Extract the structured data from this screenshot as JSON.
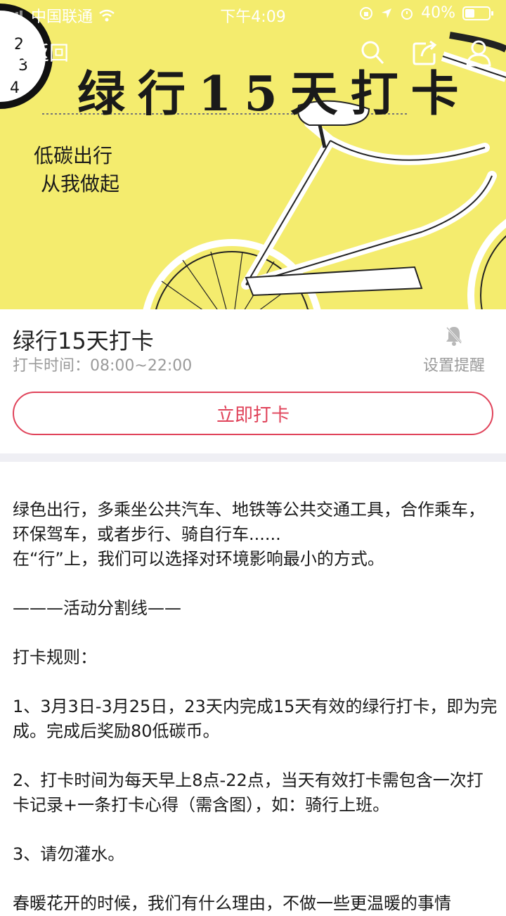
{
  "status_bar": {
    "carrier": "中国联通",
    "time": "下午4:09",
    "battery": "40%"
  },
  "nav": {
    "back_label": "返回"
  },
  "hero": {
    "title": "绿行15天打卡",
    "slogan_line1": "低碳出行",
    "slogan_line2": "从我做起",
    "background_color": "#f4ec6e"
  },
  "activity": {
    "title": "绿行15天打卡",
    "time_text": "打卡时间：08:00~22:00",
    "remind_label": "设置提醒",
    "checkin_label": "立即打卡",
    "accent_color": "#e0435a"
  },
  "description": [
    "绿色出行，多乘坐公共汽车、地铁等公共交通工具，合作乘车，环保驾车，或者步行、骑自行车......",
    "在“行”上，我们可以选择对环境影响最小的方式。",
    "",
    "———活动分割线——",
    "",
    "打卡规则：",
    "",
    "1、3月3日-3月25日，23天内完成15天有效的绿行打卡，即为完成。完成后奖励80低碳币。",
    "",
    "2、打卡时间为每天早上8点-22点，当天有效打卡需包含一次打卡记录+一条打卡心得（需含图），如：骑行上班。",
    "",
    "3、请勿灌水。",
    "",
    "春暖花开的时候，我们有什么理由，不做一些更温暖的事情"
  ]
}
